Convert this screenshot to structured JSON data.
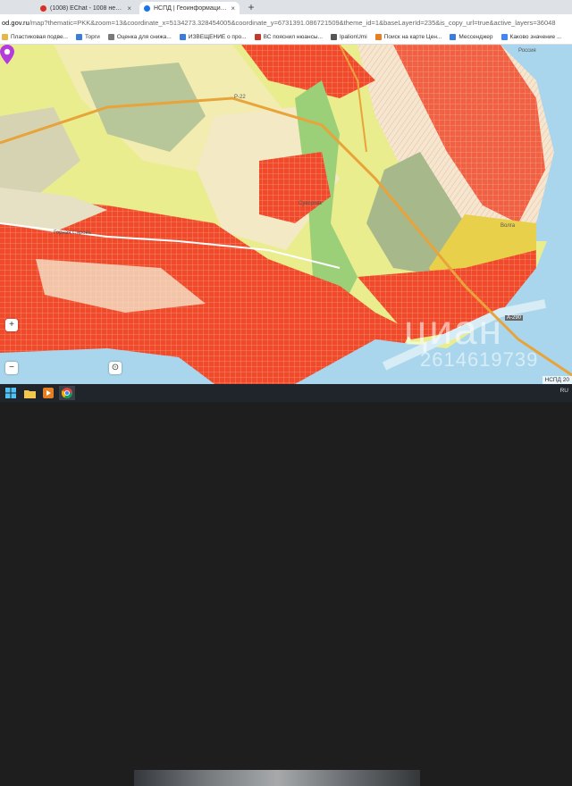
{
  "browser": {
    "tabs": [
      {
        "title": "(1008) EChat - 1008 непрочитанн",
        "favicon_color": "#d93025",
        "active": false
      },
      {
        "title": "НСПД | Геоинформационный п",
        "favicon_color": "#1a73e8",
        "active": true
      }
    ],
    "new_tab_label": "+",
    "address_domain": "od.gov.ru",
    "address_rest": "/map?thematic=PKK&zoom=13&coordinate_x=5134273.328454005&coordinate_y=6731391.086721509&theme_id=1&baseLayerId=235&is_copy_url=true&active_layers=36048"
  },
  "bookmarks": [
    {
      "label": "Пластиковая подве...",
      "color": "#e8b54a"
    },
    {
      "label": "Торги",
      "color": "#3c7dd9"
    },
    {
      "label": "Оценка для снижа...",
      "color": "#7a7a7a"
    },
    {
      "label": "ИЗВЕЩЕНИЕ о про...",
      "color": "#3c7dd9"
    },
    {
      "label": "ВС пояснил нюансы...",
      "color": "#c0392b"
    },
    {
      "label": "IpalionUmi",
      "color": "#555555"
    },
    {
      "label": "Поиск на карте Цен...",
      "color": "#e67e22"
    },
    {
      "label": "Мессенджер",
      "color": "#3c7dd9"
    },
    {
      "label": "Каково значение ...",
      "color": "#4285f4"
    }
  ],
  "map": {
    "zoom_in": "+",
    "zoom_out": "−",
    "locate": "⊙",
    "copyright": "НСПД 20",
    "labels": {
      "river": "Волга",
      "road_top": "Р-22",
      "road_right": "Россия",
      "highway": "A-290",
      "street": "Горная Сарова",
      "village": "Суворовк"
    },
    "watermark": "циан",
    "watermark_id": "2614619739",
    "colors": {
      "parcel_red": "#f04a2b",
      "land_yellow": "#e9ed8e",
      "forest_green": "#9bcf78",
      "road_orange": "#e8a33a",
      "water_blue": "#a9d6ec",
      "pin_purple": "#b43cdc"
    }
  },
  "taskbar": {
    "lang": "RU",
    "apps": [
      "start",
      "file-explorer",
      "media-player",
      "chrome"
    ]
  }
}
